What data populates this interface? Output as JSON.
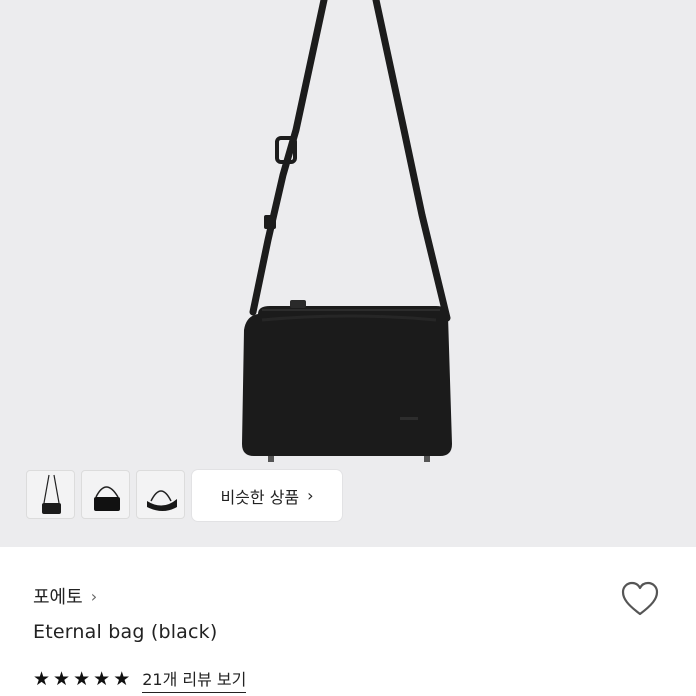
{
  "product": {
    "hero_image_desc": "black leather crossbody bag",
    "thumbnails": [
      "bag-thumbnail-1",
      "bag-thumbnail-2",
      "bag-thumbnail-3"
    ],
    "similar_button_label": "비슷한 상품",
    "brand": "포에토",
    "title": "Eternal bag (black)",
    "rating": {
      "stars": 5,
      "max": 5
    },
    "review_link": "21개 리뷰 보기"
  },
  "icons": {
    "chevron": "chevron-right-icon",
    "heart": "heart-outline-icon",
    "star": "star-filled-icon"
  },
  "colors": {
    "hero_background": "#ececee",
    "bag": "#1a1a1a",
    "text": "#222222"
  }
}
